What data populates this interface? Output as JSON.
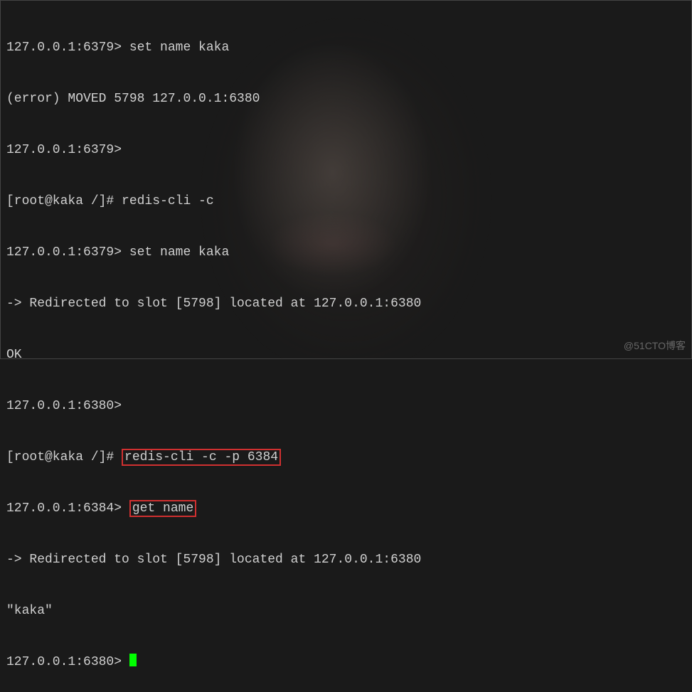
{
  "terminal": {
    "lines": [
      {
        "prompt": "127.0.0.1:6379> ",
        "cmd": "set name kaka"
      },
      {
        "text": "(error) MOVED 5798 127.0.0.1:6380"
      },
      {
        "prompt": "127.0.0.1:6379> ",
        "cmd": ""
      },
      {
        "prompt": "[root@kaka /]# ",
        "cmd": "redis-cli -c"
      },
      {
        "prompt": "127.0.0.1:6379> ",
        "cmd": "set name kaka"
      },
      {
        "text": "-> Redirected to slot [5798] located at 127.0.0.1:6380"
      },
      {
        "text": "OK"
      },
      {
        "prompt": "127.0.0.1:6380> ",
        "cmd": ""
      },
      {
        "prompt": "[root@kaka /]# ",
        "cmd": "redis-cli -c -p 6384",
        "highlight": true
      },
      {
        "prompt": "127.0.0.1:6384> ",
        "cmd": "get name",
        "highlight": true
      },
      {
        "text": "-> Redirected to slot [5798] located at 127.0.0.1:6380"
      },
      {
        "text": "\"kaka\""
      },
      {
        "prompt": "127.0.0.1:6380> ",
        "cursor": true
      }
    ]
  },
  "watermark": "@51CTO博客"
}
